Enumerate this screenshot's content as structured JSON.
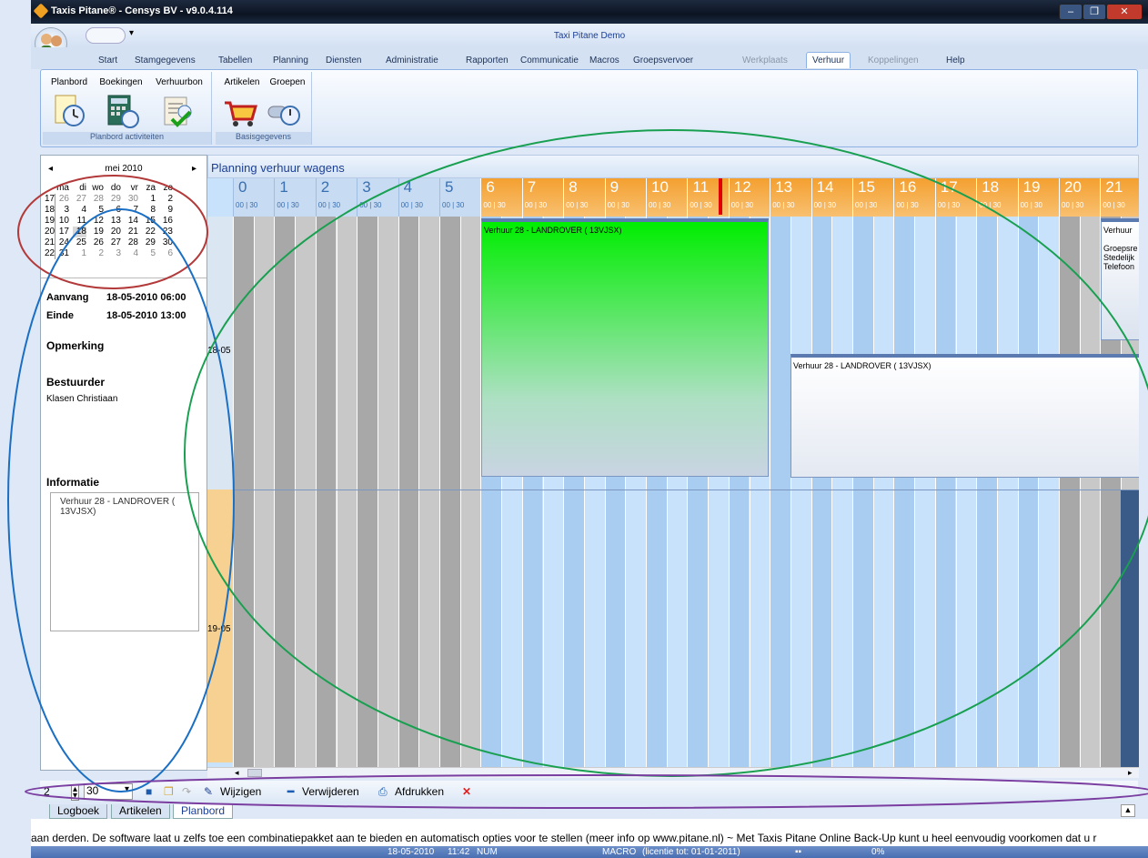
{
  "window": {
    "title": "Taxis Pitane® - Censys BV - v9.0.4.114",
    "app_name": "Taxi Pitane Demo",
    "controls": [
      "minimize",
      "restore",
      "close"
    ]
  },
  "menu": {
    "tabs": [
      "Start",
      "Stamgegevens",
      "Tabellen",
      "Planning",
      "Diensten",
      "Administratie",
      "Rapporten",
      "Communicatie",
      "Macros",
      "Groepsvervoer",
      "Werkplaats",
      "Verhuur",
      "Koppelingen",
      "Help"
    ],
    "active": "Verhuur"
  },
  "ribbon": {
    "groups": [
      {
        "label": "Planbord activiteiten",
        "buttons": [
          "Planbord",
          "Boekingen",
          "Verhuurbon"
        ]
      },
      {
        "label": "Basisgegevens",
        "buttons": [
          "Artikelen",
          "Groepen"
        ]
      }
    ]
  },
  "calendar": {
    "month": "mei 2010",
    "days": [
      "ma",
      "di",
      "wo",
      "do",
      "vr",
      "za",
      "zo"
    ],
    "weeks": [
      {
        "wk": "17",
        "d": [
          "26",
          "27",
          "28",
          "29",
          "30",
          "1",
          "2"
        ]
      },
      {
        "wk": "18",
        "d": [
          "3",
          "4",
          "5",
          "6",
          "7",
          "8",
          "9"
        ]
      },
      {
        "wk": "19",
        "d": [
          "10",
          "11",
          "12",
          "13",
          "14",
          "15",
          "16"
        ]
      },
      {
        "wk": "20",
        "d": [
          "17",
          "18",
          "19",
          "20",
          "21",
          "22",
          "23"
        ]
      },
      {
        "wk": "21",
        "d": [
          "24",
          "25",
          "26",
          "27",
          "28",
          "29",
          "30"
        ]
      },
      {
        "wk": "22",
        "d": [
          "31",
          "1",
          "2",
          "3",
          "4",
          "5",
          "6"
        ]
      }
    ],
    "selected": "18"
  },
  "details": {
    "aanvang_label": "Aanvang",
    "aanvang_value": "18-05-2010 06:00",
    "einde_label": "Einde",
    "einde_value": "18-05-2010 13:00",
    "opmerking_label": "Opmerking",
    "bestuurder_label": "Bestuurder",
    "bestuurder_value": "Klasen Christiaan",
    "informatie_label": "Informatie",
    "informatie_value": "Verhuur 28 - LANDROVER ( 13VJSX)"
  },
  "schedule": {
    "title": "Planning verhuur wagens",
    "hours": [
      "0",
      "1",
      "2",
      "3",
      "4",
      "5",
      "6",
      "7",
      "8",
      "9",
      "10",
      "11",
      "12",
      "13",
      "14",
      "15",
      "16",
      "17",
      "18",
      "19",
      "20",
      "21"
    ],
    "sub_label": "00 | 30",
    "rows": [
      "18-05",
      "19-05"
    ],
    "events": {
      "ev1": "Verhuur 28 - LANDROVER ( 13VJSX)",
      "ev2": "Verhuur 28 - LANDROVER ( 13VJSX)",
      "ev3_title": "Verhuur",
      "ev3_lines": [
        "Groepsre",
        "Stedelijk",
        "Telefoon"
      ]
    },
    "colors": {
      "header_day": "#f4a030",
      "header_night": "#c7dcf3",
      "event_green": "#00ee00",
      "current_time": "#e00000"
    }
  },
  "toolbar": {
    "spinner_value": "2",
    "interval_value": "30",
    "wijzigen": "Wijzigen",
    "verwijderen": "Verwijderen",
    "afdrukken": "Afdrukken"
  },
  "bottom_tabs": [
    "Logboek",
    "Artikelen",
    "Planbord"
  ],
  "ticker": "aan derden. De software laat u zelfs toe een combinatiepakket aan te bieden en automatisch opties voor te stellen (meer info op www.pitane.nl) ~ Met Taxis Pitane Online Back-Up kunt u heel eenvoudig voorkomen dat u r",
  "status": {
    "date": "18-05-2010",
    "time": "11:42",
    "num": "NUM",
    "macro": "MACRO",
    "license": "(licentie tot: 01-01-2011)",
    "progress": "0%"
  }
}
